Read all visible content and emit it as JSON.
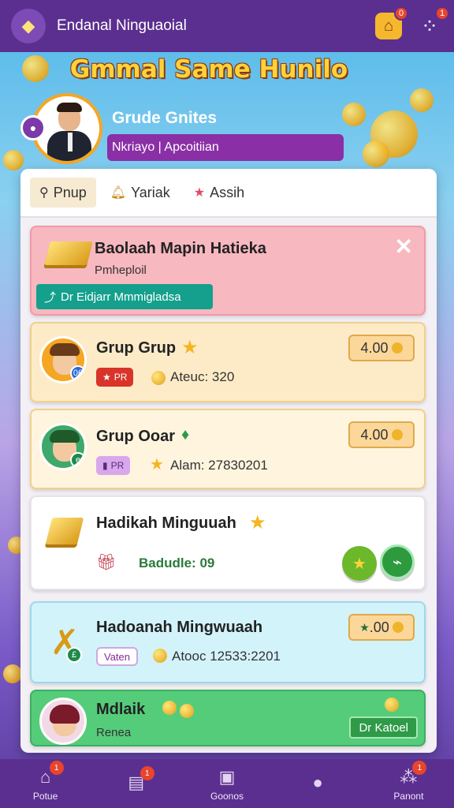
{
  "app": {
    "title": "Endanal Ninguaoial"
  },
  "topbar": {
    "home_badge": "0",
    "menu_badge": "1"
  },
  "banner": {
    "title": "Gmmal Same Hunilo"
  },
  "profile": {
    "name": "Grude Gnites",
    "subtitle": "Nkriayo | Apcoitiian"
  },
  "tabs": [
    {
      "label": "Pnup",
      "icon": "pin-icon"
    },
    {
      "label": "Yariak",
      "icon": "bell-icon"
    },
    {
      "label": "Assih",
      "icon": "star-icon"
    }
  ],
  "cards": {
    "promo": {
      "title": "Baolaah Mapin Hatieka",
      "sub": "Pmheploil",
      "button": "Dr Eidjarr Mmmigladsa"
    },
    "grup1": {
      "title": "Grup Grup",
      "tag": "PR",
      "meta": "Ateuc: 320",
      "price": "4.00"
    },
    "grup2": {
      "title": "Grup Ooar",
      "tag": "PR",
      "meta": "Alam: 27830201",
      "price": "4.00"
    },
    "hadikah": {
      "title": "Hadikah Minguuah",
      "meta": "Badudle: 09"
    },
    "hadoanah": {
      "title": "Hadoanah Mingwuaah",
      "tag": "Vaten",
      "meta": "Atooc 12533:2201",
      "price": ".00"
    },
    "mdlaik": {
      "title": "Mdlaik",
      "sub": "Renea",
      "button": "Dr Katoel"
    }
  },
  "bottomnav": [
    {
      "label": "Potue",
      "icon": "home-icon",
      "badge": "1"
    },
    {
      "label": "",
      "icon": "news-icon",
      "badge": "1"
    },
    {
      "label": "Goonos",
      "icon": "bag-icon",
      "badge": ""
    },
    {
      "label": "",
      "icon": "chat-icon",
      "badge": ""
    },
    {
      "label": "Panont",
      "icon": "group-icon",
      "badge": "1"
    }
  ],
  "colors": {
    "primary": "#5b2f8f",
    "accent": "#f5b72e",
    "teal": "#14a08c",
    "green": "#55cc7a"
  }
}
